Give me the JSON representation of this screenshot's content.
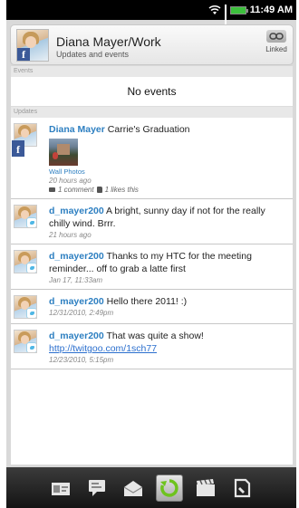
{
  "status_bar": {
    "time": "11:49 AM",
    "battery_color": "#3cbf3c"
  },
  "header": {
    "name": "Diana Mayer/Work",
    "subtitle": "Updates and events",
    "linked_label": "Linked"
  },
  "events": {
    "section_label": "Events",
    "empty_text": "No events"
  },
  "updates": {
    "section_label": "Updates",
    "items": [
      {
        "source": "facebook",
        "author": "Diana Mayer",
        "text": " Carrie's Graduation",
        "attachment_label": "Wall Photos",
        "time": "20 hours ago",
        "comments": "1 comment",
        "likes": "1 likes this"
      },
      {
        "source": "twitter",
        "author": "d_mayer200",
        "text": " A bright, sunny day if not for the really chilly wind. Brrr.",
        "time": "21 hours ago"
      },
      {
        "source": "twitter",
        "author": "d_mayer200",
        "text": " Thanks to my HTC for the meeting reminder... off to grab a latte first",
        "time": "Jan 17, 11:33am"
      },
      {
        "source": "twitter",
        "author": "d_mayer200",
        "text": " Hello there 2011! :)",
        "time": "12/31/2010, 2:49pm"
      },
      {
        "source": "twitter",
        "author": "d_mayer200",
        "text": " That was quite a show! ",
        "link": "http://twitgoo.com/1sch77",
        "time": "12/23/2010, 5:15pm"
      }
    ]
  },
  "toolbar": {
    "icons": [
      "contact-card-icon",
      "messages-icon",
      "mail-icon",
      "updates-refresh-icon",
      "gallery-icon",
      "call-history-icon"
    ],
    "active_index": 3,
    "accent": "#6ec31e"
  }
}
